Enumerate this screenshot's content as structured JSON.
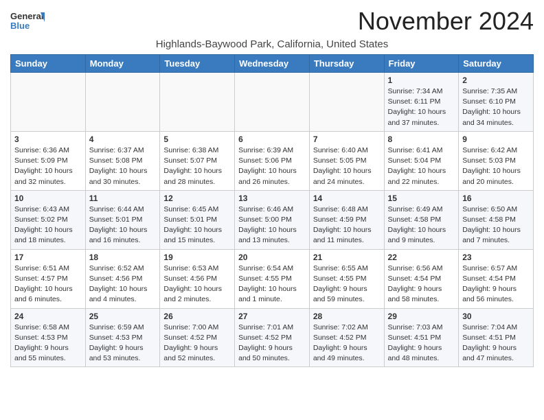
{
  "logo": {
    "line1": "General",
    "line2": "Blue"
  },
  "title": "November 2024",
  "location": "Highlands-Baywood Park, California, United States",
  "weekdays": [
    "Sunday",
    "Monday",
    "Tuesday",
    "Wednesday",
    "Thursday",
    "Friday",
    "Saturday"
  ],
  "weeks": [
    [
      {
        "day": "",
        "info": ""
      },
      {
        "day": "",
        "info": ""
      },
      {
        "day": "",
        "info": ""
      },
      {
        "day": "",
        "info": ""
      },
      {
        "day": "",
        "info": ""
      },
      {
        "day": "1",
        "info": "Sunrise: 7:34 AM\nSunset: 6:11 PM\nDaylight: 10 hours\nand 37 minutes."
      },
      {
        "day": "2",
        "info": "Sunrise: 7:35 AM\nSunset: 6:10 PM\nDaylight: 10 hours\nand 34 minutes."
      }
    ],
    [
      {
        "day": "3",
        "info": "Sunrise: 6:36 AM\nSunset: 5:09 PM\nDaylight: 10 hours\nand 32 minutes."
      },
      {
        "day": "4",
        "info": "Sunrise: 6:37 AM\nSunset: 5:08 PM\nDaylight: 10 hours\nand 30 minutes."
      },
      {
        "day": "5",
        "info": "Sunrise: 6:38 AM\nSunset: 5:07 PM\nDaylight: 10 hours\nand 28 minutes."
      },
      {
        "day": "6",
        "info": "Sunrise: 6:39 AM\nSunset: 5:06 PM\nDaylight: 10 hours\nand 26 minutes."
      },
      {
        "day": "7",
        "info": "Sunrise: 6:40 AM\nSunset: 5:05 PM\nDaylight: 10 hours\nand 24 minutes."
      },
      {
        "day": "8",
        "info": "Sunrise: 6:41 AM\nSunset: 5:04 PM\nDaylight: 10 hours\nand 22 minutes."
      },
      {
        "day": "9",
        "info": "Sunrise: 6:42 AM\nSunset: 5:03 PM\nDaylight: 10 hours\nand 20 minutes."
      }
    ],
    [
      {
        "day": "10",
        "info": "Sunrise: 6:43 AM\nSunset: 5:02 PM\nDaylight: 10 hours\nand 18 minutes."
      },
      {
        "day": "11",
        "info": "Sunrise: 6:44 AM\nSunset: 5:01 PM\nDaylight: 10 hours\nand 16 minutes."
      },
      {
        "day": "12",
        "info": "Sunrise: 6:45 AM\nSunset: 5:01 PM\nDaylight: 10 hours\nand 15 minutes."
      },
      {
        "day": "13",
        "info": "Sunrise: 6:46 AM\nSunset: 5:00 PM\nDaylight: 10 hours\nand 13 minutes."
      },
      {
        "day": "14",
        "info": "Sunrise: 6:48 AM\nSunset: 4:59 PM\nDaylight: 10 hours\nand 11 minutes."
      },
      {
        "day": "15",
        "info": "Sunrise: 6:49 AM\nSunset: 4:58 PM\nDaylight: 10 hours\nand 9 minutes."
      },
      {
        "day": "16",
        "info": "Sunrise: 6:50 AM\nSunset: 4:58 PM\nDaylight: 10 hours\nand 7 minutes."
      }
    ],
    [
      {
        "day": "17",
        "info": "Sunrise: 6:51 AM\nSunset: 4:57 PM\nDaylight: 10 hours\nand 6 minutes."
      },
      {
        "day": "18",
        "info": "Sunrise: 6:52 AM\nSunset: 4:56 PM\nDaylight: 10 hours\nand 4 minutes."
      },
      {
        "day": "19",
        "info": "Sunrise: 6:53 AM\nSunset: 4:56 PM\nDaylight: 10 hours\nand 2 minutes."
      },
      {
        "day": "20",
        "info": "Sunrise: 6:54 AM\nSunset: 4:55 PM\nDaylight: 10 hours\nand 1 minute."
      },
      {
        "day": "21",
        "info": "Sunrise: 6:55 AM\nSunset: 4:55 PM\nDaylight: 9 hours\nand 59 minutes."
      },
      {
        "day": "22",
        "info": "Sunrise: 6:56 AM\nSunset: 4:54 PM\nDaylight: 9 hours\nand 58 minutes."
      },
      {
        "day": "23",
        "info": "Sunrise: 6:57 AM\nSunset: 4:54 PM\nDaylight: 9 hours\nand 56 minutes."
      }
    ],
    [
      {
        "day": "24",
        "info": "Sunrise: 6:58 AM\nSunset: 4:53 PM\nDaylight: 9 hours\nand 55 minutes."
      },
      {
        "day": "25",
        "info": "Sunrise: 6:59 AM\nSunset: 4:53 PM\nDaylight: 9 hours\nand 53 minutes."
      },
      {
        "day": "26",
        "info": "Sunrise: 7:00 AM\nSunset: 4:52 PM\nDaylight: 9 hours\nand 52 minutes."
      },
      {
        "day": "27",
        "info": "Sunrise: 7:01 AM\nSunset: 4:52 PM\nDaylight: 9 hours\nand 50 minutes."
      },
      {
        "day": "28",
        "info": "Sunrise: 7:02 AM\nSunset: 4:52 PM\nDaylight: 9 hours\nand 49 minutes."
      },
      {
        "day": "29",
        "info": "Sunrise: 7:03 AM\nSunset: 4:51 PM\nDaylight: 9 hours\nand 48 minutes."
      },
      {
        "day": "30",
        "info": "Sunrise: 7:04 AM\nSunset: 4:51 PM\nDaylight: 9 hours\nand 47 minutes."
      }
    ]
  ]
}
